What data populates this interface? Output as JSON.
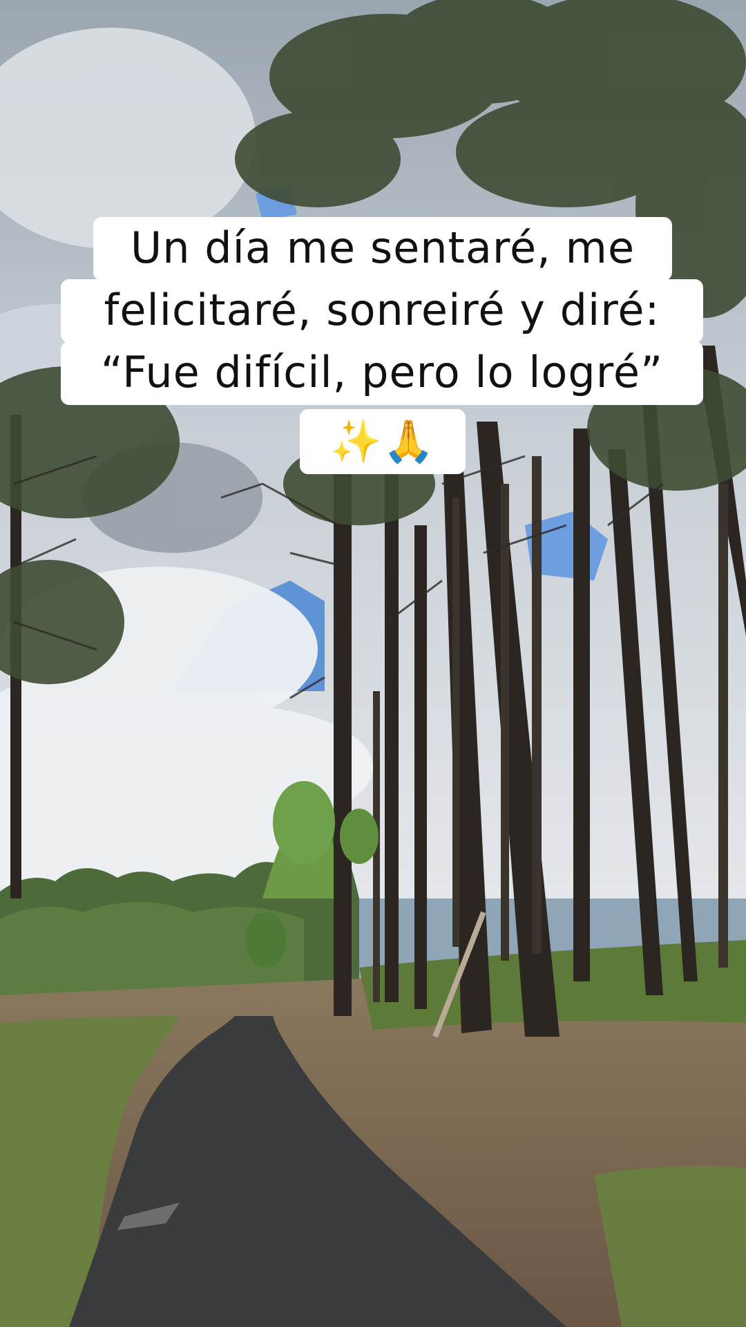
{
  "caption": {
    "line1": "Un día me sentaré, me",
    "line2": "felicitaré, sonreiré y diré:",
    "line3": "“Fue difícil, pero lo logré”",
    "line4": "✨🙏"
  },
  "colors": {
    "caption_background": "#ffffff",
    "caption_text": "#111111",
    "sky": "#6f9fd8",
    "cloud": "#e9edf1",
    "trunk": "#2b2622",
    "foliage": "#3e4b33",
    "path": "#3a3b3d",
    "ground": "#7a6450",
    "grass": "#6f8a45"
  }
}
